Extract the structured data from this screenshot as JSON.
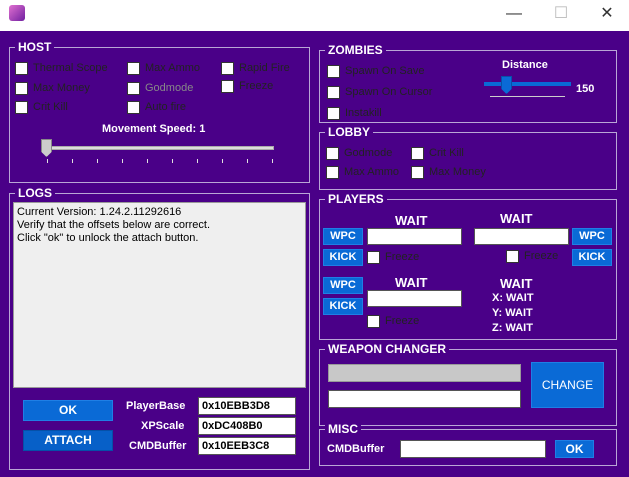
{
  "window": {
    "minimize": "—",
    "maximize": "☐",
    "close": "✕"
  },
  "host": {
    "title": "HOST",
    "checks": [
      "Thermal Scope",
      "Max Ammo",
      "Rapid Fire",
      "Max Money",
      "Godmode",
      "Freeze",
      "Crit Kill",
      "Auto fire"
    ],
    "speed_label": "Movement Speed:",
    "speed_value": "1"
  },
  "logs": {
    "title": "LOGS",
    "lines": [
      "Current Version: 1.24.2.11292616",
      "Verify that the offsets below are correct.",
      "Click \"ok\" to unlock the attach button."
    ],
    "ok_label": "OK",
    "attach_label": "ATTACH",
    "offsets": [
      {
        "label": "PlayerBase",
        "value": "0x10EBB3D8"
      },
      {
        "label": "XPScale",
        "value": "0xDC408B0"
      },
      {
        "label": "CMDBuffer",
        "value": "0x10EEB3C8"
      }
    ]
  },
  "zombies": {
    "title": "ZOMBIES",
    "checks": [
      "Spawn On Save",
      "Spawn On Cursor",
      "Instakill"
    ],
    "distance_label": "Distance",
    "distance_value": "150"
  },
  "lobby": {
    "title": "LOBBY",
    "checks": [
      "Godmode",
      "Crit Kill",
      "Max Ammo",
      "Max Money"
    ]
  },
  "players": {
    "title": "PLAYERS",
    "wait": "WAIT",
    "wpc": "WPC",
    "kick": "KICK",
    "freeze": "Freeze",
    "coords": [
      "X:  WAIT",
      "Y:  WAIT",
      "Z:  WAIT"
    ]
  },
  "weapon": {
    "title": "WEAPON CHANGER",
    "change_label": "CHANGE"
  },
  "misc": {
    "title": "MISC",
    "cmd_label": "CMDBuffer",
    "ok_label": "OK"
  }
}
